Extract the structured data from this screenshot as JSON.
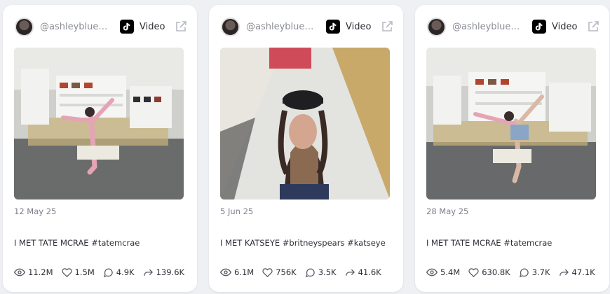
{
  "cards": [
    {
      "handle": "@ashleyblued…",
      "type_label": "Video",
      "date": "12 May 25",
      "caption": "I MET TATE MCRAE #tatemcrae",
      "views": "11.2M",
      "likes": "1.5M",
      "comments": "4.9K",
      "shares": "139.6K"
    },
    {
      "handle": "@ashleyblued…",
      "type_label": "Video",
      "date": "5 Jun 25",
      "caption": "I MET KATSEYE #britneyspears #katseye",
      "views": "6.1M",
      "likes": "756K",
      "comments": "3.5K",
      "shares": "41.6K"
    },
    {
      "handle": "@ashleyblued…",
      "type_label": "Video",
      "date": "28 May 25",
      "caption": "I MET TATE MCRAE #tatemcrae",
      "views": "5.4M",
      "likes": "630.8K",
      "comments": "3.7K",
      "shares": "47.1K"
    }
  ],
  "colors": {
    "background": "#eef0f3",
    "card": "#ffffff",
    "muted_text": "#7b7f88",
    "icon_gray": "#555a63"
  },
  "icons": [
    "avatar",
    "tiktok-icon",
    "external-link-icon",
    "eye-icon",
    "heart-icon",
    "comment-icon",
    "share-icon"
  ]
}
